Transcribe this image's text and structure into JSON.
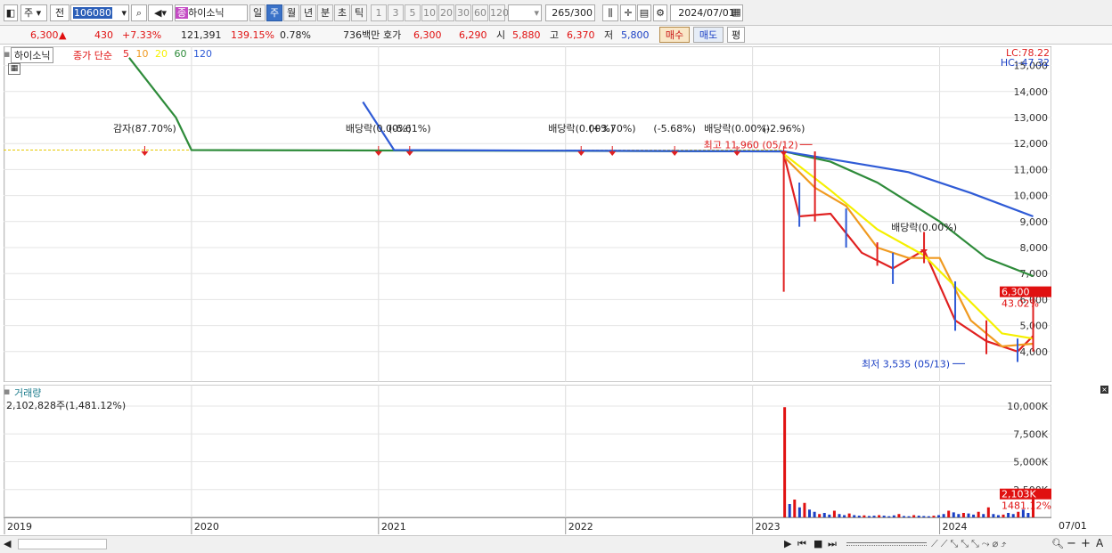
{
  "toolbar": {
    "market": "주",
    "type": "전",
    "code": "106080",
    "name": "하이소닉",
    "badge": "종",
    "periods": [
      "일",
      "주",
      "월",
      "년",
      "분",
      "초",
      "틱"
    ],
    "minutes": [
      "1",
      "3",
      "5",
      "10",
      "20",
      "30",
      "60",
      "120"
    ],
    "count": "265",
    "count_total": "/300",
    "date": "2024/07/01"
  },
  "quote": {
    "price": "6,300",
    "change_arrow": "▲",
    "change": "430",
    "change_pct": "+7.33%",
    "volume": "121,391",
    "volume_ratio": "139.15%",
    "turnover": "0.78%",
    "amount": "736백만",
    "bid_label": "호가",
    "ask": "6,300",
    "bid": "6,290",
    "open_label": "시",
    "open": "5,880",
    "high_label": "고",
    "high": "6,370",
    "low_label": "저",
    "low": "5,800",
    "buy_button": "매수",
    "sell_button": "매도",
    "eval_button": "평"
  },
  "price_panel": {
    "stock_label": "하이소닉",
    "ma_label": "종가 단순",
    "ma_periods": [
      "5",
      "10",
      "20",
      "60",
      "120"
    ],
    "lc": "LC:78.22",
    "hc": "HC:-47.32",
    "current_price": "6,300",
    "current_pct": "43.02%",
    "high_note": "최고 11,960 (05/12)",
    "low_note": "최저 3,535 (05/13)",
    "events": [
      "감자(87.70%)",
      "배당락(0.00%)",
      "(-6.61%)",
      "배당락(0.00%)",
      "(+3.70%)",
      "(-5.68%)",
      "배당락(0.00%)",
      "(-2.96%)",
      "배당락(0.00%)"
    ],
    "y_ticks": [
      "15,000",
      "14,000",
      "13,000",
      "12,000",
      "11,000",
      "10,000",
      "9,000",
      "8,000",
      "7,000",
      "6,000",
      "5,000",
      "4,000"
    ]
  },
  "volume_panel": {
    "title": "거래량",
    "value": "2,102,828주(1,481.12%)",
    "current": "2,103K",
    "current_pct": "1481.12%",
    "y_ticks": [
      "10,000K",
      "7,500K",
      "5,000K",
      "2,500K"
    ]
  },
  "x_axis": {
    "years": [
      "2019",
      "2020",
      "2021",
      "2022",
      "2023",
      "2024"
    ],
    "end_label": "07/01"
  },
  "chart_data": {
    "type": "line",
    "title": "",
    "series": [
      {
        "name": "5",
        "color": "#e02020",
        "x": [
          "2023-03",
          "2023-04",
          "2023-06",
          "2023-08",
          "2023-10",
          "2023-12",
          "2024-02",
          "2024-04",
          "2024-06",
          "2024-07"
        ],
        "values": [
          11600,
          9200,
          9300,
          7800,
          7200,
          7900,
          5200,
          4400,
          4000,
          4600
        ]
      },
      {
        "name": "10",
        "color": "#f09a20",
        "x": [
          "2023-03",
          "2023-05",
          "2023-07",
          "2023-09",
          "2023-11",
          "2024-01",
          "2024-03",
          "2024-05",
          "2024-07"
        ],
        "values": [
          11500,
          10300,
          9600,
          8000,
          7600,
          7600,
          5200,
          4200,
          4300
        ]
      },
      {
        "name": "20",
        "color": "#f5f000",
        "x": [
          "2023-03",
          "2023-06",
          "2023-09",
          "2023-12",
          "2024-02",
          "2024-05",
          "2024-07"
        ],
        "values": [
          11600,
          10200,
          8700,
          7700,
          6500,
          4700,
          4500
        ]
      },
      {
        "name": "60",
        "color": "#2e8b3a",
        "x": [
          "2019-09",
          "2019-12",
          "2020-01",
          "2023-03",
          "2023-06",
          "2023-09",
          "2024-01",
          "2024-04",
          "2024-07"
        ],
        "values": [
          15300,
          13000,
          11750,
          11700,
          11300,
          10500,
          9000,
          7600,
          6900
        ]
      },
      {
        "name": "120",
        "color": "#2f5bd6",
        "x": [
          "2020-12",
          "2021-02",
          "2023-03",
          "2023-07",
          "2023-11",
          "2024-03",
          "2024-07"
        ],
        "values": [
          13600,
          11750,
          11700,
          11300,
          10900,
          10100,
          9200
        ]
      }
    ],
    "flat_price": 11750,
    "ylim": [
      3000,
      15500
    ],
    "xlim": [
      "2019-01",
      "2024-08"
    ],
    "grid": true,
    "legend": "top-left"
  }
}
